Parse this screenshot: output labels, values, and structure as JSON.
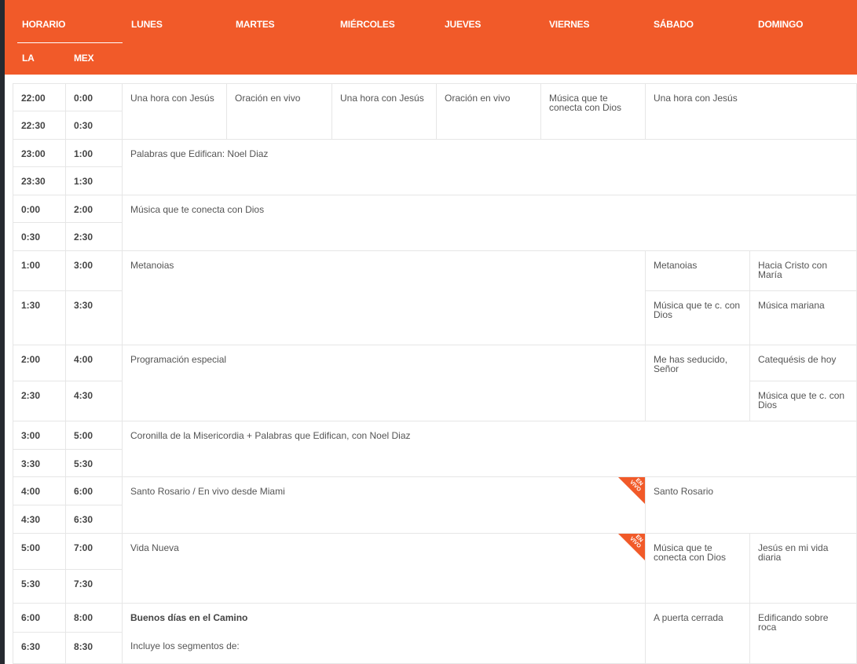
{
  "header": {
    "horario": "HORARIO",
    "la": "LA",
    "mex": "MEX",
    "days": [
      "LUNES",
      "MARTES",
      "MIÉRCOLES",
      "JUEVES",
      "VIERNES",
      "SÁBADO",
      "DOMINGO"
    ]
  },
  "times": [
    {
      "la": "22:00",
      "mex": "0:00"
    },
    {
      "la": "22:30",
      "mex": "0:30"
    },
    {
      "la": "23:00",
      "mex": "1:00"
    },
    {
      "la": "23:30",
      "mex": "1:30"
    },
    {
      "la": "0:00",
      "mex": "2:00"
    },
    {
      "la": "0:30",
      "mex": "2:30"
    },
    {
      "la": "1:00",
      "mex": "3:00"
    },
    {
      "la": "1:30",
      "mex": "3:30"
    },
    {
      "la": "2:00",
      "mex": "4:00"
    },
    {
      "la": "2:30",
      "mex": "4:30"
    },
    {
      "la": "3:00",
      "mex": "5:00"
    },
    {
      "la": "3:30",
      "mex": "5:30"
    },
    {
      "la": "4:00",
      "mex": "6:00"
    },
    {
      "la": "4:30",
      "mex": "6:30"
    },
    {
      "la": "5:00",
      "mex": "7:00"
    },
    {
      "la": "5:30",
      "mex": "7:30"
    },
    {
      "la": "6:00",
      "mex": "8:00"
    },
    {
      "la": "6:30",
      "mex": "8:30"
    }
  ],
  "programs": {
    "p_r0_lun": "Una hora con Jesús",
    "p_r0_mar": "Oración en vivo",
    "p_r0_mie": "Una hora con Jesús",
    "p_r0_jue": "Oración en vivo",
    "p_r0_vie": "Música que te conecta con Dios",
    "p_r0_sab": "Una hora con Jesús",
    "p_r2": "Palabras que Edifican: Noel Diaz",
    "p_r4": "Música que te conecta con Dios",
    "p_r6_wk": "Metanoias",
    "p_r6_sab": "Metanoias",
    "p_r6_dom": "Hacia Cristo con María",
    "p_r7_sab": "Música que te c. con Dios",
    "p_r7_dom": "Música mariana",
    "p_r8_wk": "Programación especial",
    "p_r8_sab": "Me has seducido, Señor",
    "p_r8_dom": "Catequésis de hoy",
    "p_r9_dom": "Música que te c. con Dios",
    "p_r10": "Coronilla de la Misericordia + Palabras que Edifican, con Noel Diaz",
    "p_r12_wk": "Santo Rosario / En vivo desde Miami",
    "p_r12_sab": "Santo Rosario",
    "p_r14_wk": "Vida Nueva",
    "p_r14_sab": "Música que te conecta con Dios",
    "p_r14_dom": "Jesús en mi vida diaria",
    "p_r16_wk_title": "Buenos días en el Camino",
    "p_r16_wk_sub": "Incluye los segmentos de:",
    "p_r16_sab": "A puerta cerrada",
    "p_r16_dom": "Edificando sobre roca"
  },
  "badge": {
    "vivo": "EN VIVO"
  },
  "colors": {
    "accent": "#f15a29",
    "background": "#262a30"
  }
}
